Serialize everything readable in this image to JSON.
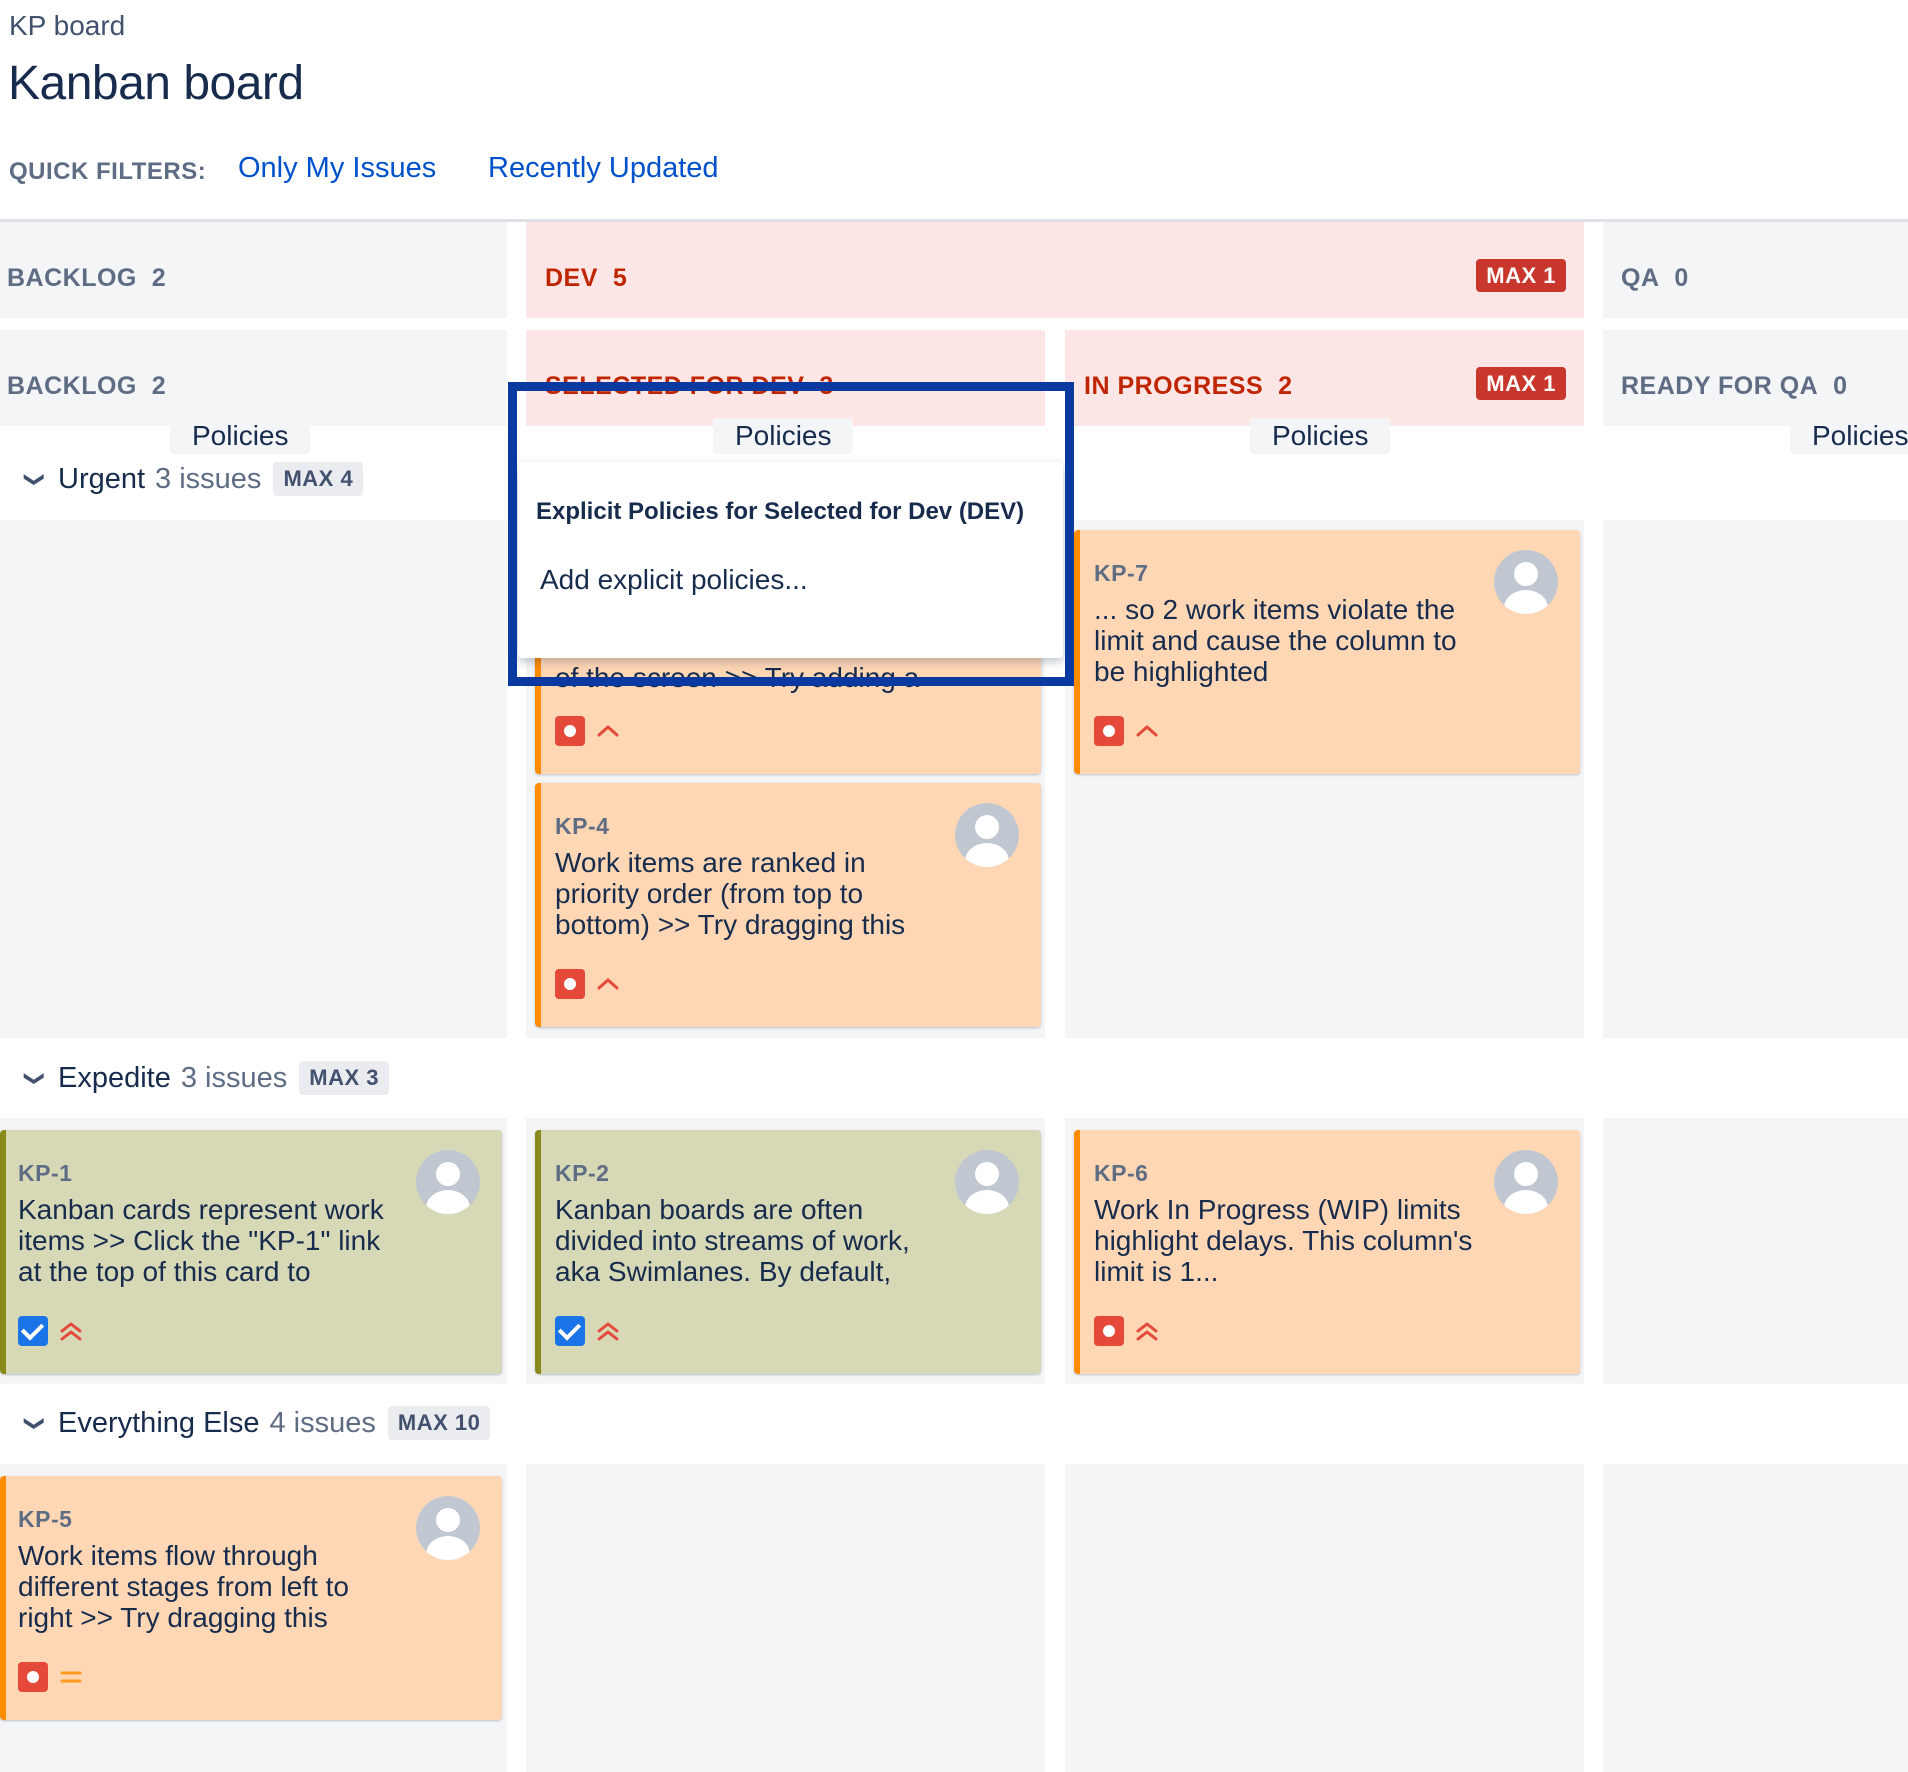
{
  "header": {
    "breadcrumb": "KP board",
    "title": "Kanban board",
    "quick_filters_label": "QUICK FILTERS:",
    "quick_filters": [
      "Only My Issues",
      "Recently Updated"
    ]
  },
  "column_groups": [
    {
      "label": "BACKLOG",
      "count": "2"
    },
    {
      "label": "DEV",
      "count": "5",
      "max": "MAX 1"
    },
    {
      "label": "QA",
      "count": "0"
    }
  ],
  "columns": [
    {
      "label": "BACKLOG",
      "count": "2",
      "policies": "Policies"
    },
    {
      "label": "SELECTED FOR DEV",
      "count": "3",
      "policies": "Policies"
    },
    {
      "label": "IN PROGRESS",
      "count": "2",
      "max": "MAX 1",
      "policies": "Policies"
    },
    {
      "label": "READY FOR QA",
      "count": "0",
      "policies": "Policies"
    }
  ],
  "swimlanes": [
    {
      "name": "Urgent",
      "count": "3 issues",
      "max": "MAX 4"
    },
    {
      "name": "Expedite",
      "count": "3 issues",
      "max": "MAX 3"
    },
    {
      "name": "Everything Else",
      "count": "4 issues",
      "max": "MAX 10"
    }
  ],
  "cards": {
    "sel_urgent_1": {
      "summary_tail": "of the screen >> Try adding a",
      "type": "bug",
      "priority": "high"
    },
    "kp7": {
      "key": "KP-7",
      "summary": "... so 2 work items violate the limit and cause the column to be highlighted",
      "type": "bug",
      "priority": "high"
    },
    "kp4": {
      "key": "KP-4",
      "summary": "Work items are ranked in priority order (from top to bottom) >> Try dragging this",
      "type": "bug",
      "priority": "high"
    },
    "kp1": {
      "key": "KP-1",
      "summary": "Kanban cards represent work items >> Click the \"KP-1\" link at the top of this card to",
      "type": "task",
      "priority": "highest"
    },
    "kp2": {
      "key": "KP-2",
      "summary": "Kanban boards are often divided into streams of work, aka Swimlanes. By default,",
      "type": "task",
      "priority": "highest"
    },
    "kp6": {
      "key": "KP-6",
      "summary": "Work In Progress (WIP) limits highlight delays. This column's limit is 1...",
      "type": "bug",
      "priority": "highest"
    },
    "kp5": {
      "key": "KP-5",
      "summary": "Work items flow through different stages from left to right >> Try dragging this",
      "type": "bug",
      "priority": "medium"
    }
  },
  "popover": {
    "title": "Explicit Policies for Selected for Dev (DEV)",
    "link": "Add explicit policies..."
  },
  "colors": {
    "red_column": "#ffe6e6",
    "max_badge": "#c9372c",
    "card_orange": "#ffd7b5",
    "card_olive": "#d6d8b6",
    "link": "#0052cc",
    "highlight_frame": "#0a3aa1"
  }
}
